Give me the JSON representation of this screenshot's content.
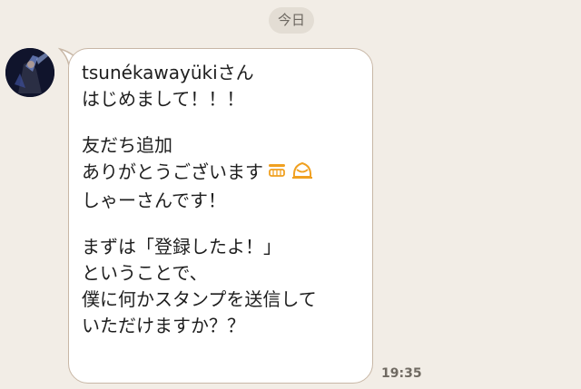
{
  "date_label": "今日",
  "message": {
    "lines_block1": [
      "tsunékawayükiさん",
      "はじめまして！！！"
    ],
    "lines_block2": [
      "友だち追加",
      "ありがとうございます",
      "しゃーさんです！"
    ],
    "lines_block3": [
      "まずは「登録したよ！」",
      "ということで、",
      "僕に何かスタンプを送信して",
      "いただけますか？？"
    ],
    "emoji_icons": [
      "grinning-face-icon",
      "bowing-person-icon"
    ],
    "time": "19:35"
  },
  "colors": {
    "background": "#f2ede6",
    "bubble": "#ffffff",
    "bubble_border": "#c8b7a6",
    "emoji": "#f0a020"
  }
}
